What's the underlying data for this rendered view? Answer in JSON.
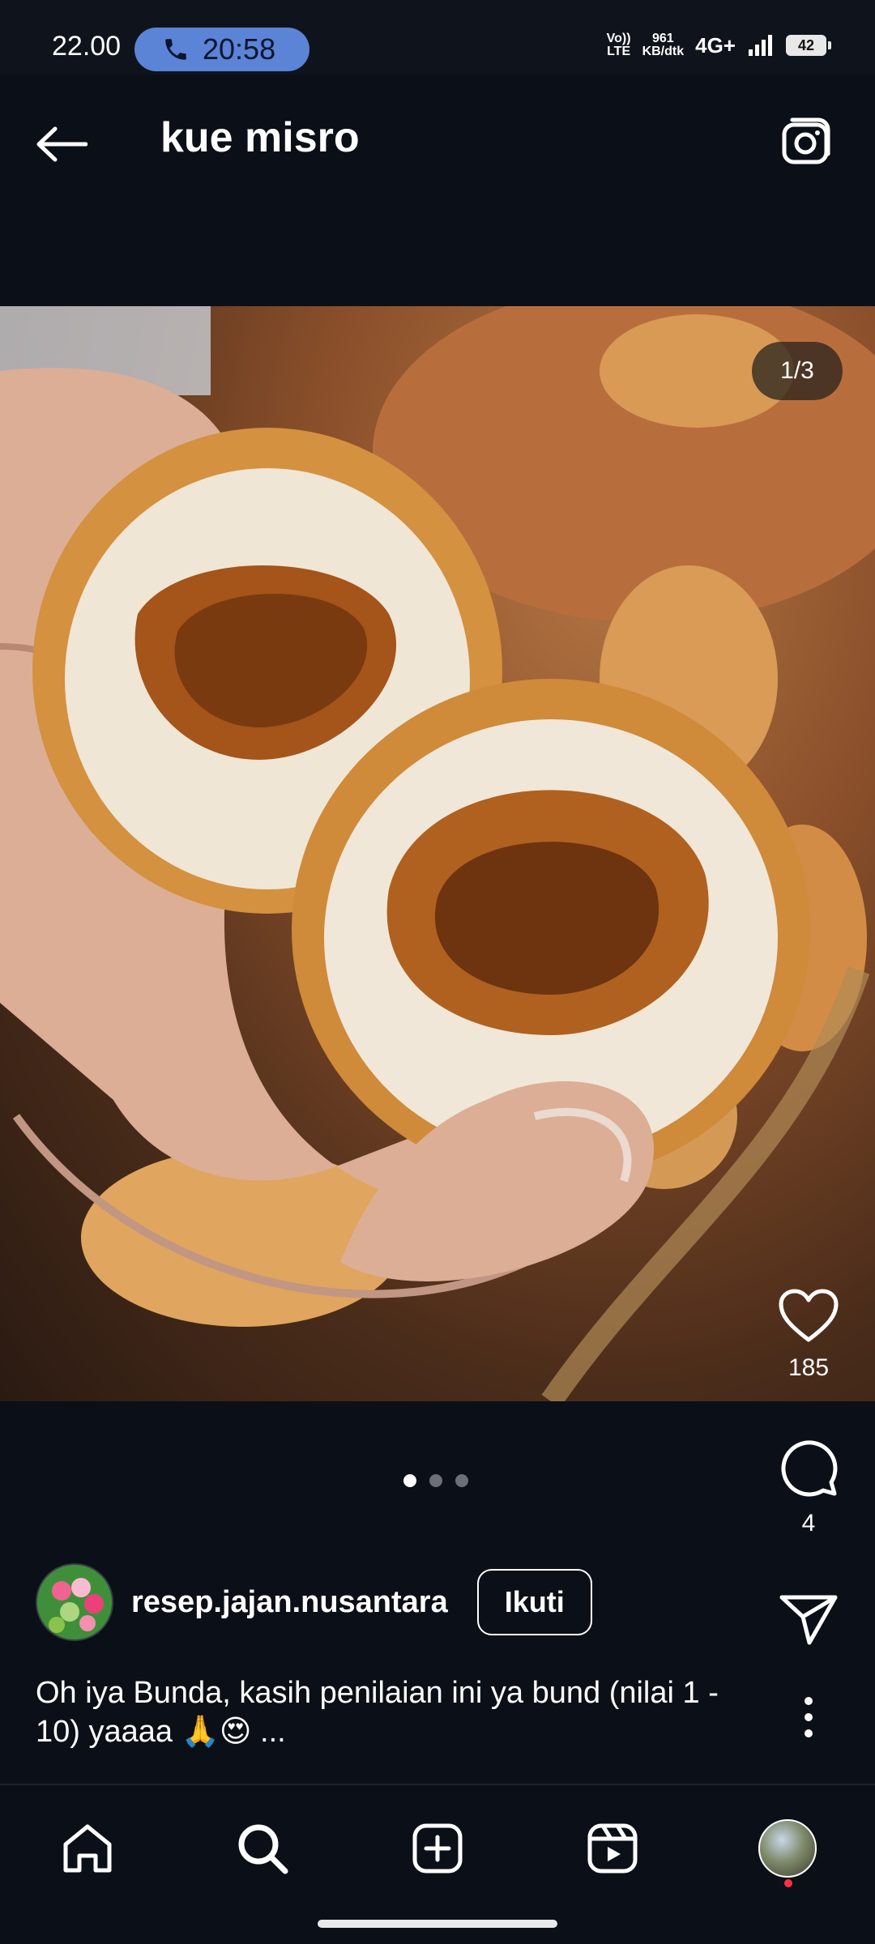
{
  "status_bar": {
    "time": "22.00",
    "call_timer": "20:58",
    "volte_line1": "Vo))",
    "volte_line2": "LTE",
    "speed_value": "961",
    "speed_unit": "KB/dtk",
    "network": "4G+",
    "battery": "42"
  },
  "header": {
    "title": "kue misro"
  },
  "post": {
    "image_counter": "1/3",
    "likes": "185",
    "comments": "4",
    "carousel_total": 3,
    "carousel_active_index": 0,
    "author": {
      "username": "resep.jajan.nusantara",
      "follow_label": "Ikuti"
    },
    "caption": "Oh iya Bunda, kasih penilaian ini ya bund (nilai 1 - 10) yaaaa 🙏😍 ..."
  },
  "icons": {
    "back": "arrow-left-icon",
    "camera": "camera-icon",
    "like": "heart-icon",
    "comment": "comment-icon",
    "share": "send-icon",
    "more": "more-vertical-icon",
    "call": "phone-icon"
  },
  "colors": {
    "background": "#0b0f17",
    "call_pill": "#5b83d6",
    "notification_dot": "#ff3040"
  }
}
